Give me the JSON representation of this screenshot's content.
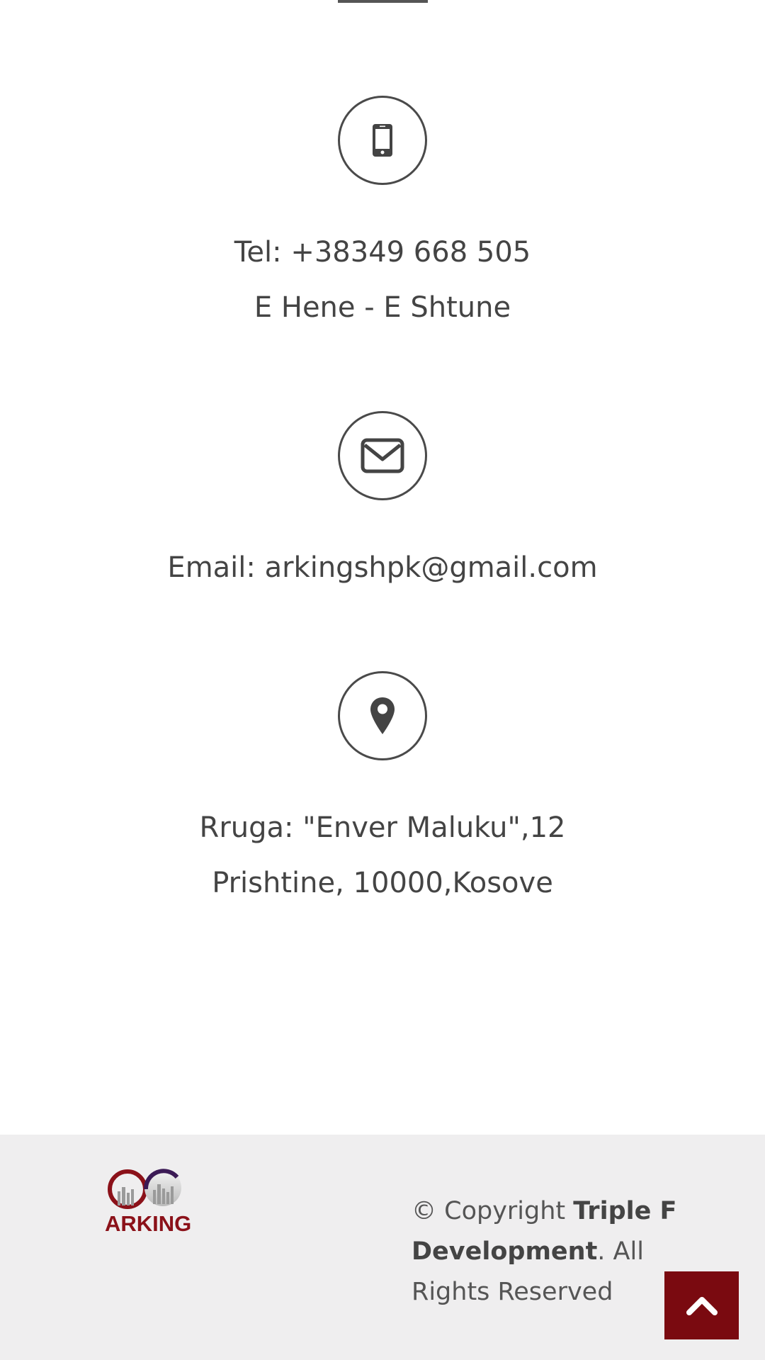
{
  "contact": {
    "phone": {
      "icon": "mobile-phone-icon",
      "lines": [
        "Tel: +38349 668 505",
        "E Hene - E Shtune"
      ]
    },
    "email": {
      "icon": "envelope-icon",
      "lines": [
        "Email: arkingshpk@gmail.com"
      ]
    },
    "address": {
      "icon": "map-pin-icon",
      "lines": [
        "Rruga: \"Enver Maluku\",12",
        "Prishtine, 10000,Kosove"
      ]
    }
  },
  "footer": {
    "logo_text": "ARKING",
    "copyright_prefix": "© Copyright ",
    "copyright_company": "Triple F Development",
    "copyright_suffix": ". All Rights Reserved",
    "back_to_top_icon": "chevron-up-icon"
  },
  "colors": {
    "brand": "#7a0a10",
    "text": "#444444",
    "footer_bg": "#efeeef",
    "logo_purple": "#3b1a55"
  }
}
